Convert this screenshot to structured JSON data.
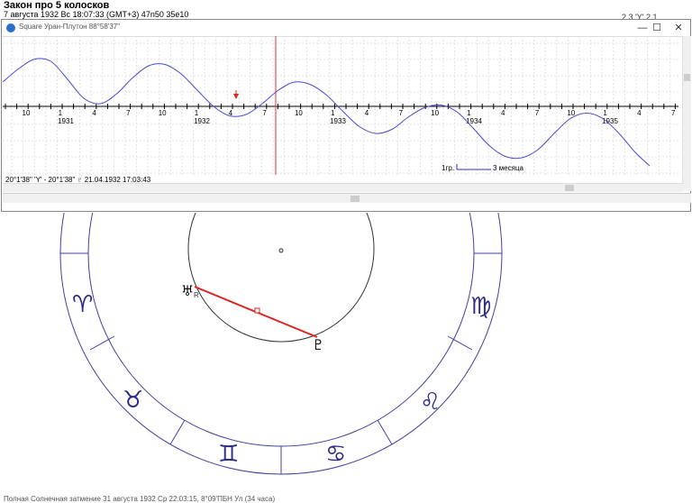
{
  "header": {
    "title": "Закон про 5 колосков",
    "subtitle": "7 августа 1932  Вс  18:07:33 (GMT+3) 47n50  35e10",
    "right_info": "2 3 'Y' 2 1"
  },
  "chart_window": {
    "title": "Square Уран-Плутон  88°58'37\"",
    "buttons": {
      "minimize": "—",
      "maximize": "☐",
      "close": "✕"
    },
    "status": "20°1'38\" 'Y' - 20°1'38\" ♇  21.04.1932 17:03:43",
    "scale_degree": "1гр.",
    "scale_period": "3 месяца"
  },
  "chart_data": {
    "type": "line",
    "month_ticks": [
      "10",
      "1",
      "4",
      "7",
      "10",
      "1",
      "4",
      "7",
      "10",
      "1",
      "4",
      "7",
      "10",
      "1",
      "4",
      "7",
      "10",
      "1",
      "4",
      "7"
    ],
    "year_labels": [
      "1931",
      "1932",
      "1933",
      "1934",
      "1935"
    ],
    "series": [
      {
        "x": [
          0,
          18,
          36,
          54,
          72,
          90,
          108,
          126,
          144,
          162,
          180,
          198,
          216,
          234,
          252,
          270,
          288,
          306,
          324,
          342,
          360,
          378,
          396,
          414,
          432,
          450,
          468,
          486,
          504,
          522,
          540,
          558,
          576,
          594,
          612,
          630,
          648,
          666,
          684,
          702,
          718
        ],
        "y": [
          1.8,
          2.8,
          3.5,
          3.3,
          2.0,
          0.6,
          0.2,
          0.9,
          2.1,
          3.0,
          3.1,
          2.4,
          1.2,
          0.0,
          -0.7,
          -0.6,
          0.2,
          1.2,
          1.8,
          1.6,
          0.8,
          -0.4,
          -1.5,
          -2.0,
          -1.7,
          -0.8,
          -0.1,
          0.1,
          -0.4,
          -1.6,
          -2.9,
          -3.7,
          -3.8,
          -3.2,
          -2.0,
          -0.9,
          -0.5,
          -0.9,
          -2.0,
          -3.4,
          -4.4
        ]
      }
    ]
  },
  "wheel": {
    "signs": [
      "♈",
      "♉",
      "♊",
      "♋",
      "♌",
      "♍"
    ],
    "planets": {
      "uranus": "♅",
      "pluto": "♇",
      "retro": "R"
    }
  },
  "bottom_text": "Полная Солнечная затмение 31 августа 1932 Ср 22:03:15, 8°09'ПБН Ул (34 часа)"
}
